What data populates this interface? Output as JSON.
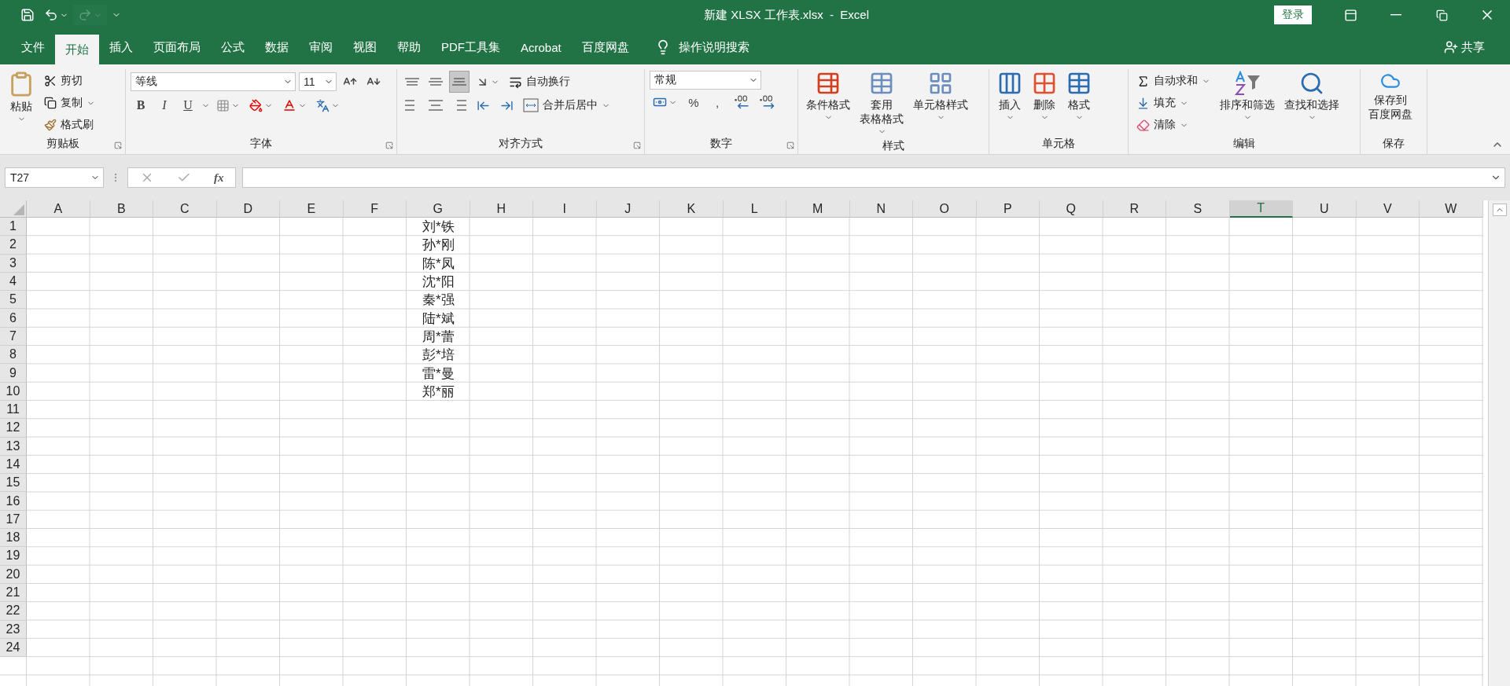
{
  "title_bar": {
    "quick_access": [
      {
        "kind": "save",
        "disabled": false
      },
      {
        "kind": "undo",
        "disabled": false
      },
      {
        "kind": "redo",
        "disabled": true
      }
    ],
    "title": "新建 XLSX 工作表.xlsx  -  Excel",
    "sign_in": "登录"
  },
  "menu_tabs": [
    {
      "label": "文件",
      "selected": false
    },
    {
      "label": "开始",
      "selected": true
    },
    {
      "label": "插入",
      "selected": false
    },
    {
      "label": "页面布局",
      "selected": false
    },
    {
      "label": "公式",
      "selected": false
    },
    {
      "label": "数据",
      "selected": false
    },
    {
      "label": "审阅",
      "selected": false
    },
    {
      "label": "视图",
      "selected": false
    },
    {
      "label": "帮助",
      "selected": false
    },
    {
      "label": "PDF工具集",
      "selected": false
    },
    {
      "label": "Acrobat",
      "selected": false
    },
    {
      "label": "百度网盘",
      "selected": false
    }
  ],
  "tell_me": "操作说明搜索",
  "share": "共享",
  "ribbon": {
    "clipboard": {
      "label": "剪贴板",
      "paste": "粘贴",
      "items": [
        "剪切",
        "复制",
        "格式刷"
      ]
    },
    "font": {
      "label": "字体",
      "font_name": "等线",
      "font_size": "11",
      "styles": [
        "B",
        "I",
        "U"
      ]
    },
    "alignment": {
      "label": "对齐方式",
      "wrap": "自动换行",
      "merge": "合并后居中",
      "vertical_align": [
        {
          "kind": "top",
          "selected": false
        },
        {
          "kind": "middle",
          "selected": false
        },
        {
          "kind": "bottom",
          "selected": true
        }
      ]
    },
    "number": {
      "label": "数字",
      "format": "常规",
      "symbols": [
        "%",
        ","
      ]
    },
    "styles": {
      "label": "样式",
      "buttons": [
        {
          "lines": [
            "条件格式"
          ]
        },
        {
          "lines": [
            "套用",
            "表格格式"
          ]
        },
        {
          "lines": [
            "单元格样式"
          ]
        }
      ]
    },
    "cells": {
      "label": "单元格",
      "buttons": [
        "插入",
        "删除",
        "格式"
      ]
    },
    "editing": {
      "label": "编辑",
      "items": [
        "自动求和",
        "填充",
        "清除"
      ],
      "buttons": [
        "排序和筛选",
        "查找和选择"
      ]
    },
    "save": {
      "label": "保存",
      "button": [
        "保存到",
        "百度网盘"
      ]
    }
  },
  "formula_bar": {
    "name_box": "T27",
    "fx": "fx"
  },
  "sheet": {
    "columns": [
      {
        "label": "A",
        "selected": false
      },
      {
        "label": "B",
        "selected": false
      },
      {
        "label": "C",
        "selected": false
      },
      {
        "label": "D",
        "selected": false
      },
      {
        "label": "E",
        "selected": false
      },
      {
        "label": "F",
        "selected": false
      },
      {
        "label": "G",
        "selected": false
      },
      {
        "label": "H",
        "selected": false
      },
      {
        "label": "I",
        "selected": false
      },
      {
        "label": "J",
        "selected": false
      },
      {
        "label": "K",
        "selected": false
      },
      {
        "label": "L",
        "selected": false
      },
      {
        "label": "M",
        "selected": false
      },
      {
        "label": "N",
        "selected": false
      },
      {
        "label": "O",
        "selected": false
      },
      {
        "label": "P",
        "selected": false
      },
      {
        "label": "Q",
        "selected": false
      },
      {
        "label": "R",
        "selected": false
      },
      {
        "label": "S",
        "selected": false
      },
      {
        "label": "T",
        "selected": true
      },
      {
        "label": "U",
        "selected": false
      },
      {
        "label": "V",
        "selected": false
      },
      {
        "label": "W",
        "selected": false
      }
    ],
    "rows": [
      {
        "header": "1",
        "column_g": "刘*铁"
      },
      {
        "header": "2",
        "column_g": "孙*刚"
      },
      {
        "header": "3",
        "column_g": "陈*凤"
      },
      {
        "header": "4",
        "column_g": "沈*阳"
      },
      {
        "header": "5",
        "column_g": "秦*强"
      },
      {
        "header": "6",
        "column_g": "陆*斌"
      },
      {
        "header": "7",
        "column_g": "周*蕾"
      },
      {
        "header": "8",
        "column_g": "彭*培"
      },
      {
        "header": "9",
        "column_g": "雷*曼"
      },
      {
        "header": "10",
        "column_g": "郑*丽"
      },
      {
        "header": "11"
      },
      {
        "header": "12"
      },
      {
        "header": "13"
      },
      {
        "header": "14"
      },
      {
        "header": "15"
      },
      {
        "header": "16"
      },
      {
        "header": "17"
      },
      {
        "header": "18"
      },
      {
        "header": "19"
      },
      {
        "header": "20"
      },
      {
        "header": "21"
      },
      {
        "header": "22"
      },
      {
        "header": "23"
      },
      {
        "header": "24"
      }
    ]
  }
}
